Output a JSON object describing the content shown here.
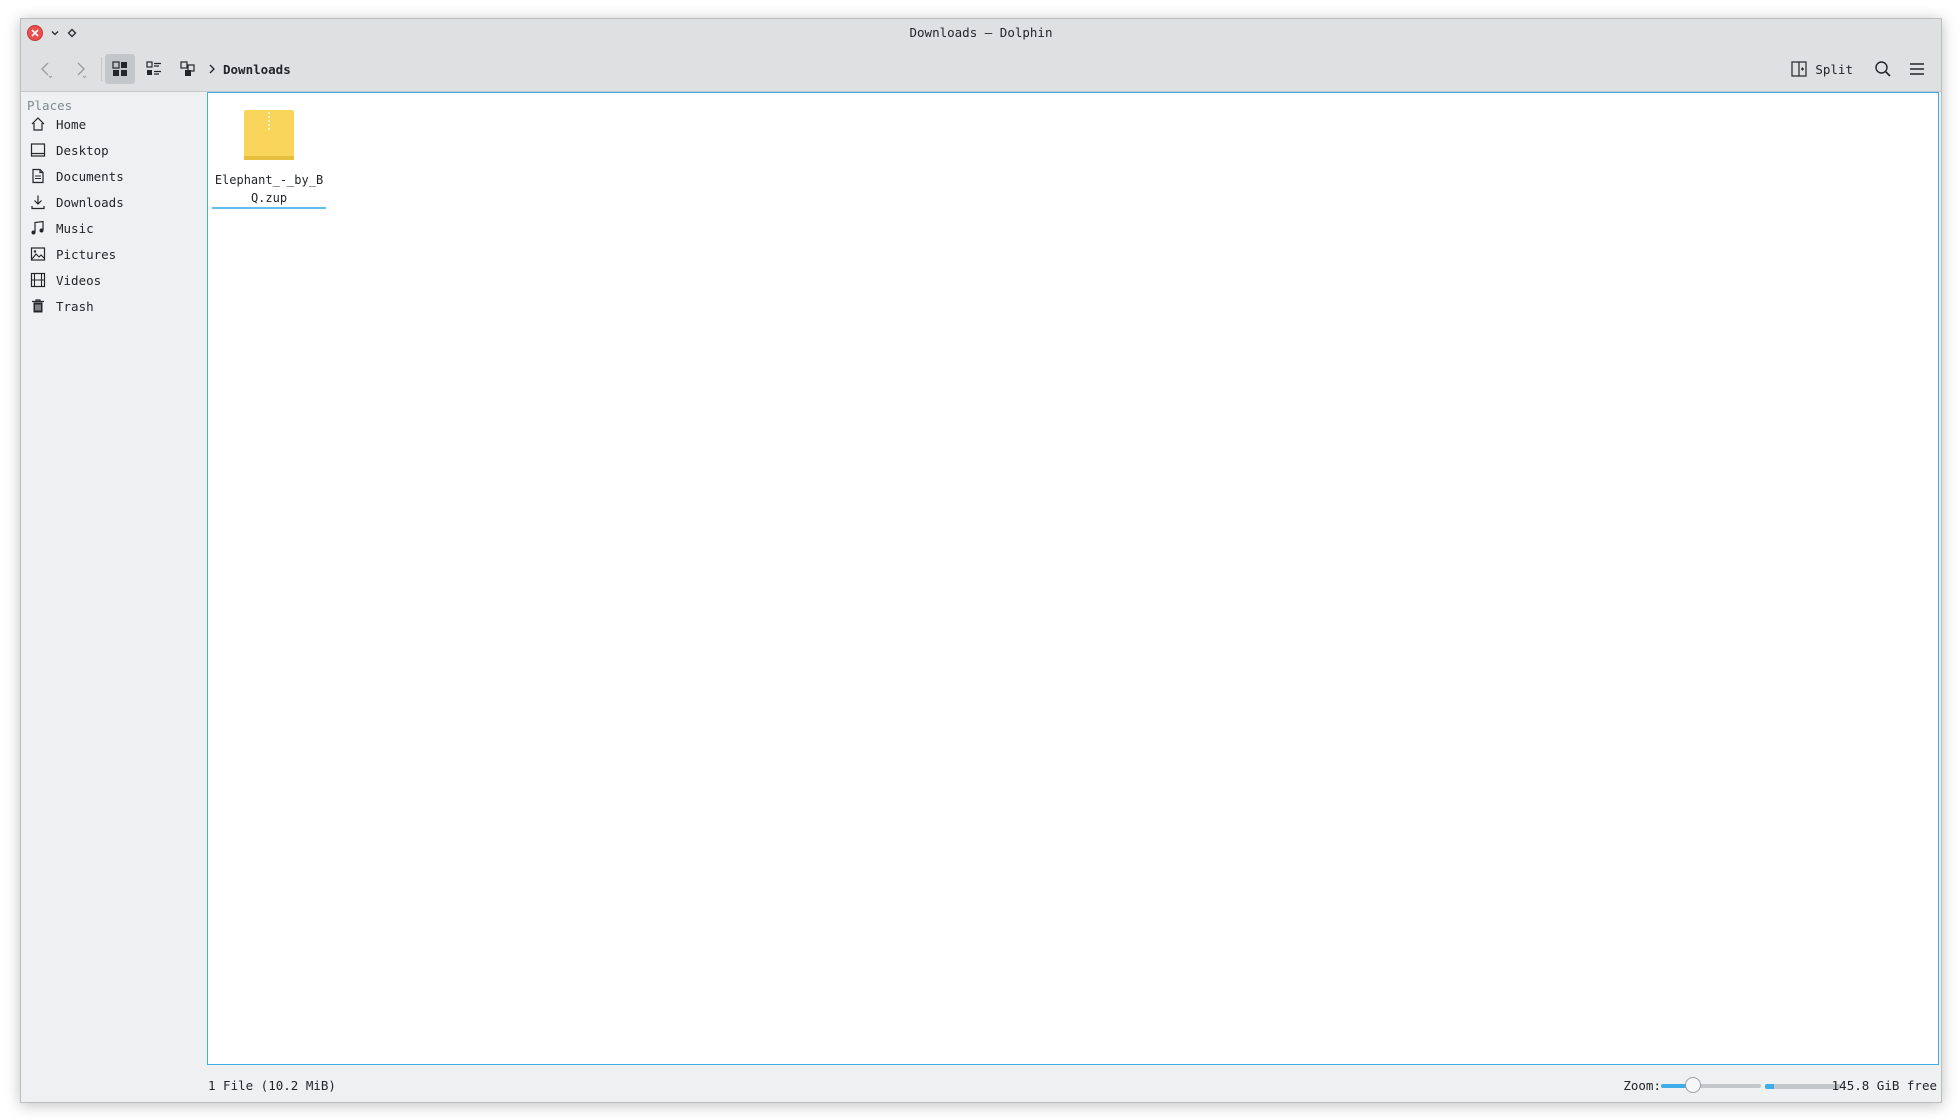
{
  "window": {
    "title": "Downloads — Dolphin"
  },
  "toolbar": {
    "breadcrumb": "Downloads",
    "split_label": "Split",
    "view_modes": [
      "icons",
      "compact",
      "details"
    ],
    "active_view": "icons"
  },
  "sidebar": {
    "heading": "Places",
    "items": [
      {
        "label": "Home",
        "icon": "home-icon"
      },
      {
        "label": "Desktop",
        "icon": "desktop-icon"
      },
      {
        "label": "Documents",
        "icon": "documents-icon"
      },
      {
        "label": "Downloads",
        "icon": "downloads-icon"
      },
      {
        "label": "Music",
        "icon": "music-icon"
      },
      {
        "label": "Pictures",
        "icon": "pictures-icon"
      },
      {
        "label": "Videos",
        "icon": "videos-icon"
      },
      {
        "label": "Trash",
        "icon": "trash-icon"
      }
    ]
  },
  "content": {
    "files": [
      {
        "name": "Elephant_-_by_BQ.zup",
        "icon": "archive-icon"
      }
    ]
  },
  "statusbar": {
    "summary": "1 File (10.2 MiB)",
    "zoom_label": "Zoom:",
    "zoom_level": 0.28,
    "free_space": "145.8 GiB free",
    "used_fraction": 0.12
  },
  "colors": {
    "accent": "#3daee9",
    "close": "#ed4c4c",
    "folder": "#f9d55b"
  }
}
